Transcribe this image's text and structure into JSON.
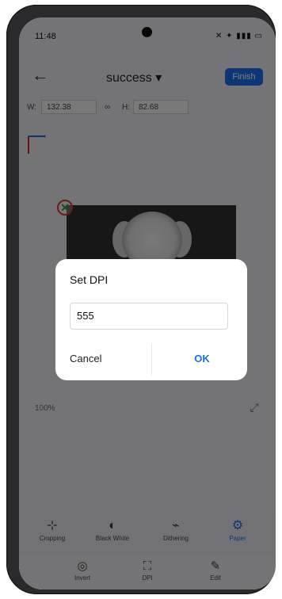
{
  "status_bar": {
    "time": "11:48",
    "icons": "✕ ✦ ▮▮▮ ▭"
  },
  "app_bar": {
    "back_icon": "←",
    "title": "success ▾",
    "finish_label": "Finish"
  },
  "size_bar": {
    "width_label": "W:",
    "width_value": "132.38",
    "link_icon": "∞",
    "height_label": "H:",
    "height_value": "82.68"
  },
  "canvas": {
    "zoom_label": "100%",
    "fit_icon": "⤢"
  },
  "toolbar_primary": [
    {
      "icon": "⊹",
      "label": "Cropping"
    },
    {
      "icon": "◐",
      "label": "Black White"
    },
    {
      "icon": "⌁",
      "label": "Dithering"
    },
    {
      "icon": "⚙",
      "label": "Paper"
    }
  ],
  "toolbar_secondary": [
    {
      "icon": "◎",
      "label": "Invert"
    },
    {
      "icon": "⛶",
      "label": "DPI"
    },
    {
      "icon": "✎",
      "label": "Edit"
    }
  ],
  "dialog": {
    "title": "Set DPI",
    "input_value": "555",
    "cancel_label": "Cancel",
    "ok_label": "OK"
  },
  "colors": {
    "accent": "#1a6fe8",
    "scrim": "rgba(0,0,0,0.5)"
  }
}
